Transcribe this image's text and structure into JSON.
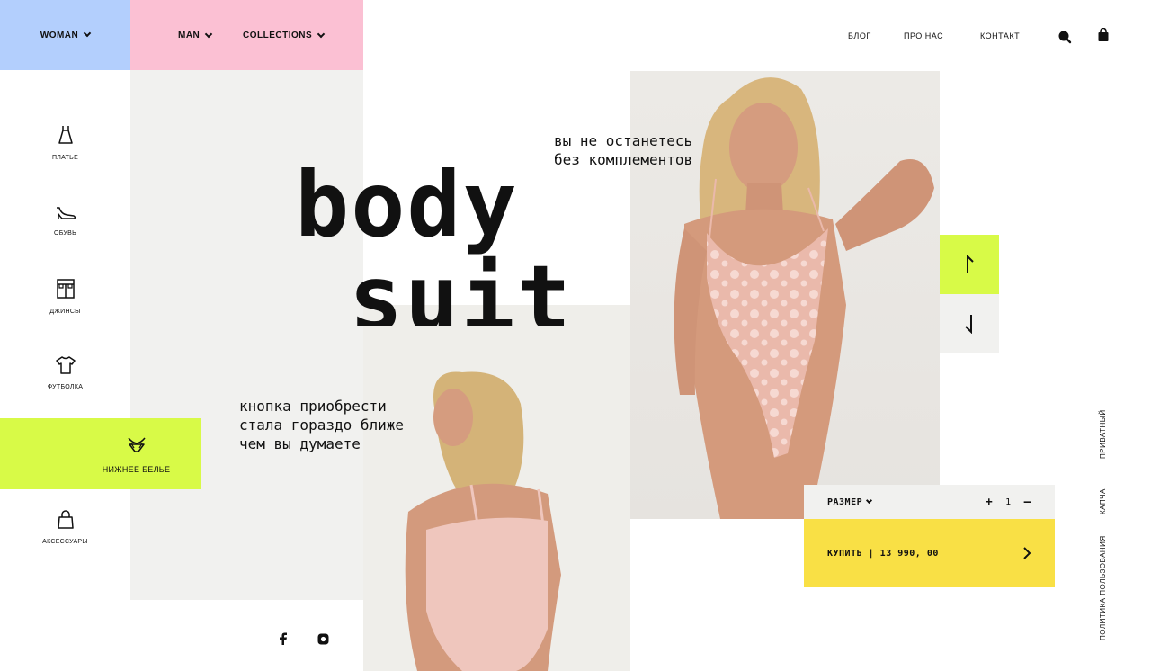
{
  "nav": {
    "woman": "WOMAN",
    "man": "MAN",
    "collections": "COLLECTIONS",
    "blog": "БЛОГ",
    "about": "ПРО НАС",
    "contact": "КОНТАКТ",
    "search_icon": "search-icon",
    "cart_icon": "shopping-bag-icon"
  },
  "categories": {
    "dress": "ПЛАТЬЕ",
    "shoes": "ОБУВЬ",
    "jeans": "ДЖИНСЫ",
    "tshirt": "ФУТБОЛКА",
    "lingerie": "НИЖНЕЕ БЕЛЬЕ",
    "accessories": "АКСЕССУАРЫ"
  },
  "hero": {
    "line1": "body",
    "line2": "suit",
    "tagline_top": "вы не останетесь\nбез комплементов",
    "tagline_bottom": "кнопка приобрести\nстала гораздо ближе\nчем вы думаете"
  },
  "product": {
    "size_label": "РАЗМЕР",
    "qty_plus": "+",
    "qty_value": "1",
    "qty_minus": "–",
    "buy_label": "КУПИТЬ | 13 990, 00"
  },
  "side_links": {
    "privacy": "ПРИВАТНЫЙ",
    "captcha": "КАПЧА",
    "terms": "ПОЛИТИКА ПОЛЬЗОВАНИЯ"
  },
  "colors": {
    "accent_lime": "#d8fa47",
    "accent_yellow": "#f9e045",
    "nav_blue": "#b3cffd",
    "nav_pink": "#fbc0d3",
    "panel_grey": "#f1f1ef"
  },
  "social": [
    "facebook-icon",
    "instagram-icon"
  ]
}
